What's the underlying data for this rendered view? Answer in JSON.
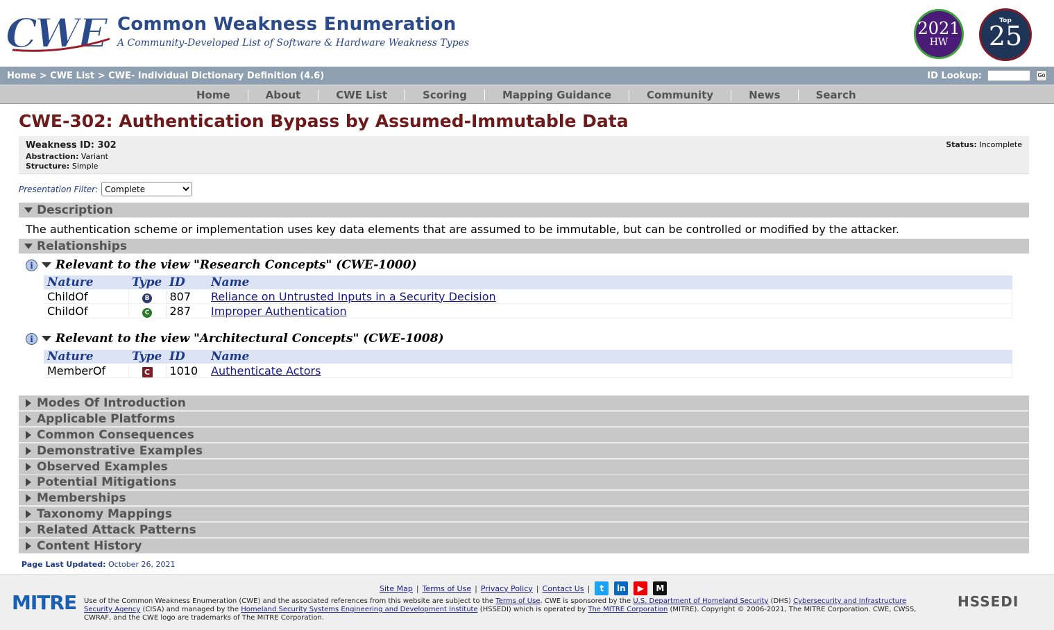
{
  "header": {
    "logo_text": "CWE",
    "title": "Common Weakness Enumeration",
    "subtitle": "A Community-Developed List of Software & Hardware Weakness Types",
    "badge_hw_year": "2021",
    "badge_hw_text": "HW",
    "badge_top_label": "Top",
    "badge_top_number": "25"
  },
  "breadcrumb": {
    "home": "Home",
    "sep": ">",
    "cwe_list": "CWE List",
    "current": "CWE- Individual Dictionary Definition (4.6)"
  },
  "id_lookup": {
    "label": "ID Lookup:",
    "value": "",
    "go": "Go"
  },
  "nav": [
    "Home",
    "About",
    "CWE List",
    "Scoring",
    "Mapping Guidance",
    "Community",
    "News",
    "Search"
  ],
  "page": {
    "title": "CWE-302: Authentication Bypass by Assumed-Immutable Data",
    "weakness_id_label": "Weakness ID:",
    "weakness_id": "302",
    "abstraction_label": "Abstraction:",
    "abstraction": "Variant",
    "structure_label": "Structure:",
    "structure": "Simple",
    "status_label": "Status:",
    "status": "Incomplete",
    "filter_label": "Presentation Filter:",
    "filter_value": "Complete"
  },
  "description": {
    "heading": "Description",
    "text": "The authentication scheme or implementation uses key data elements that are assumed to be immutable, but can be controlled or modified by the attacker."
  },
  "relationships": {
    "heading": "Relationships",
    "columns": [
      "Nature",
      "Type",
      "ID",
      "Name"
    ],
    "views": [
      {
        "title": "Relevant to the view \"Research Concepts\" (CWE-1000)",
        "rows": [
          {
            "nature": "ChildOf",
            "type": "B",
            "id": "807",
            "name": "Reliance on Untrusted Inputs in a Security Decision"
          },
          {
            "nature": "ChildOf",
            "type": "C",
            "id": "287",
            "name": "Improper Authentication"
          }
        ]
      },
      {
        "title": "Relevant to the view \"Architectural Concepts\" (CWE-1008)",
        "rows": [
          {
            "nature": "MemberOf",
            "type": "C",
            "id": "1010",
            "name": "Authenticate Actors"
          }
        ]
      }
    ]
  },
  "collapsed_sections": [
    "Modes Of Introduction",
    "Applicable Platforms",
    "Common Consequences",
    "Demonstrative Examples",
    "Observed Examples",
    "Potential Mitigations",
    "Memberships",
    "Taxonomy Mappings",
    "Related Attack Patterns",
    "Content History"
  ],
  "updated": {
    "label": "Page Last Updated:",
    "date": "October 26, 2021"
  },
  "footer": {
    "links": [
      "Site Map",
      "Terms of Use",
      "Privacy Policy",
      "Contact Us"
    ],
    "social": [
      "twitter-icon",
      "linkedin-icon",
      "youtube-icon",
      "medium-icon"
    ],
    "mitre_logo": "MITRE",
    "hssedi_logo": "HSSEDI",
    "t1": "Use of the Common Weakness Enumeration (CWE) and the associated references from this website are subject to the ",
    "l1": "Terms of Use",
    "t2": ". CWE is sponsored by the ",
    "l2": "U.S. Department of Homeland Security",
    "t3": " (DHS) ",
    "l3": "Cybersecurity and Infrastructure Security Agency",
    "t4": " (CISA) and managed by the ",
    "l4": "Homeland Security Systems Engineering and Development Institute",
    "t5": " (HSSEDI) which is operated by ",
    "l5": "The MITRE Corporation",
    "t6": " (MITRE). Copyright © 2006-2021, The MITRE Corporation. CWE, CWSS, CWRAF, and the CWE logo are trademarks of The MITRE Corporation."
  },
  "colors": {
    "title": "#6f1a1a",
    "nav_bg": "#c8c8c8",
    "crumb_bg": "#8d9fb0",
    "brand_blue": "#2b4a8a"
  }
}
